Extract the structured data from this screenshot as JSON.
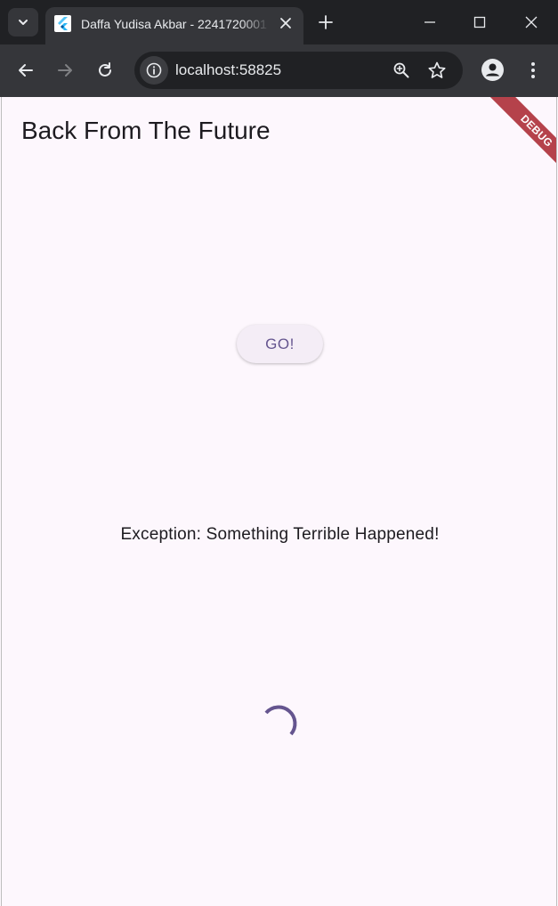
{
  "browser": {
    "tab_title": "Daffa Yudisa Akbar - 2241720001",
    "url": "localhost:58825",
    "icons": {
      "tab_search": "chevron-down-icon",
      "favicon": "flutter-icon",
      "tab_close": "close-icon",
      "new_tab": "plus-icon",
      "minimize": "minimize-icon",
      "maximize": "maximize-icon",
      "window_close": "close-icon",
      "back": "back-arrow-icon",
      "forward": "forward-arrow-icon",
      "reload": "reload-icon",
      "site_info": "info-icon",
      "zoom": "zoom-in-icon",
      "bookmark": "star-icon",
      "profile": "profile-icon",
      "menu": "kebab-menu-icon"
    }
  },
  "app": {
    "title": "Back From The Future",
    "debug_banner": "DEBUG",
    "go_button_label": "GO!",
    "result_text": "Exception: Something Terrible Happened!",
    "loading": true,
    "colors": {
      "background": "#fdf7fd",
      "primary": "#65558f",
      "button_bg": "#f4edf6",
      "debug_banner": "#b5424b"
    }
  }
}
